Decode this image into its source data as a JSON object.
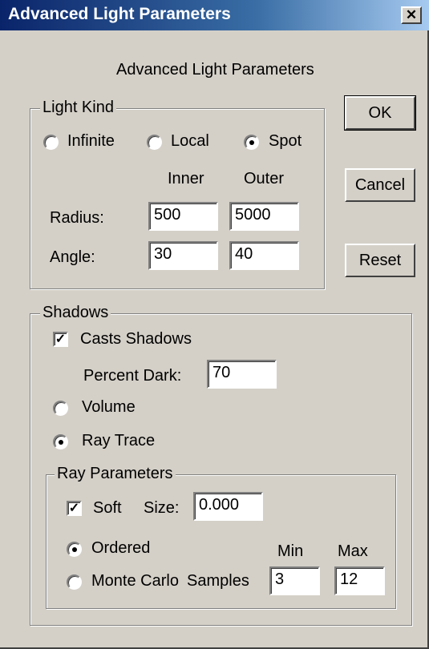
{
  "window": {
    "title": "Advanced Light Parameters",
    "close_glyph": "✕"
  },
  "header": "Advanced Light Parameters",
  "buttons": {
    "ok": "OK",
    "cancel": "Cancel",
    "reset": "Reset"
  },
  "light_kind": {
    "legend": "Light Kind",
    "options": [
      {
        "label": "Infinite",
        "selected": false
      },
      {
        "label": "Local",
        "selected": false
      },
      {
        "label": "Spot",
        "selected": true
      }
    ],
    "col_inner": "Inner",
    "col_outer": "Outer",
    "radius_label": "Radius:",
    "radius_inner": "500",
    "radius_outer": "5000",
    "angle_label": "Angle:",
    "angle_inner": "30",
    "angle_outer": "40"
  },
  "shadows": {
    "legend": "Shadows",
    "casts_label": "Casts Shadows",
    "casts_checked": true,
    "percent_label": "Percent Dark:",
    "percent_value": "70",
    "volume_label": "Volume",
    "volume_selected": false,
    "raytrace_label": "Ray Trace",
    "raytrace_selected": true
  },
  "ray": {
    "legend": "Ray Parameters",
    "soft_label": "Soft",
    "soft_checked": true,
    "size_label": "Size:",
    "size_value": "0.000",
    "ordered_label": "Ordered",
    "ordered_selected": true,
    "monte_label": "Monte Carlo",
    "monte_selected": false,
    "samples_label": "Samples",
    "min_label": "Min",
    "max_label": "Max",
    "min_value": "3",
    "max_value": "12"
  }
}
